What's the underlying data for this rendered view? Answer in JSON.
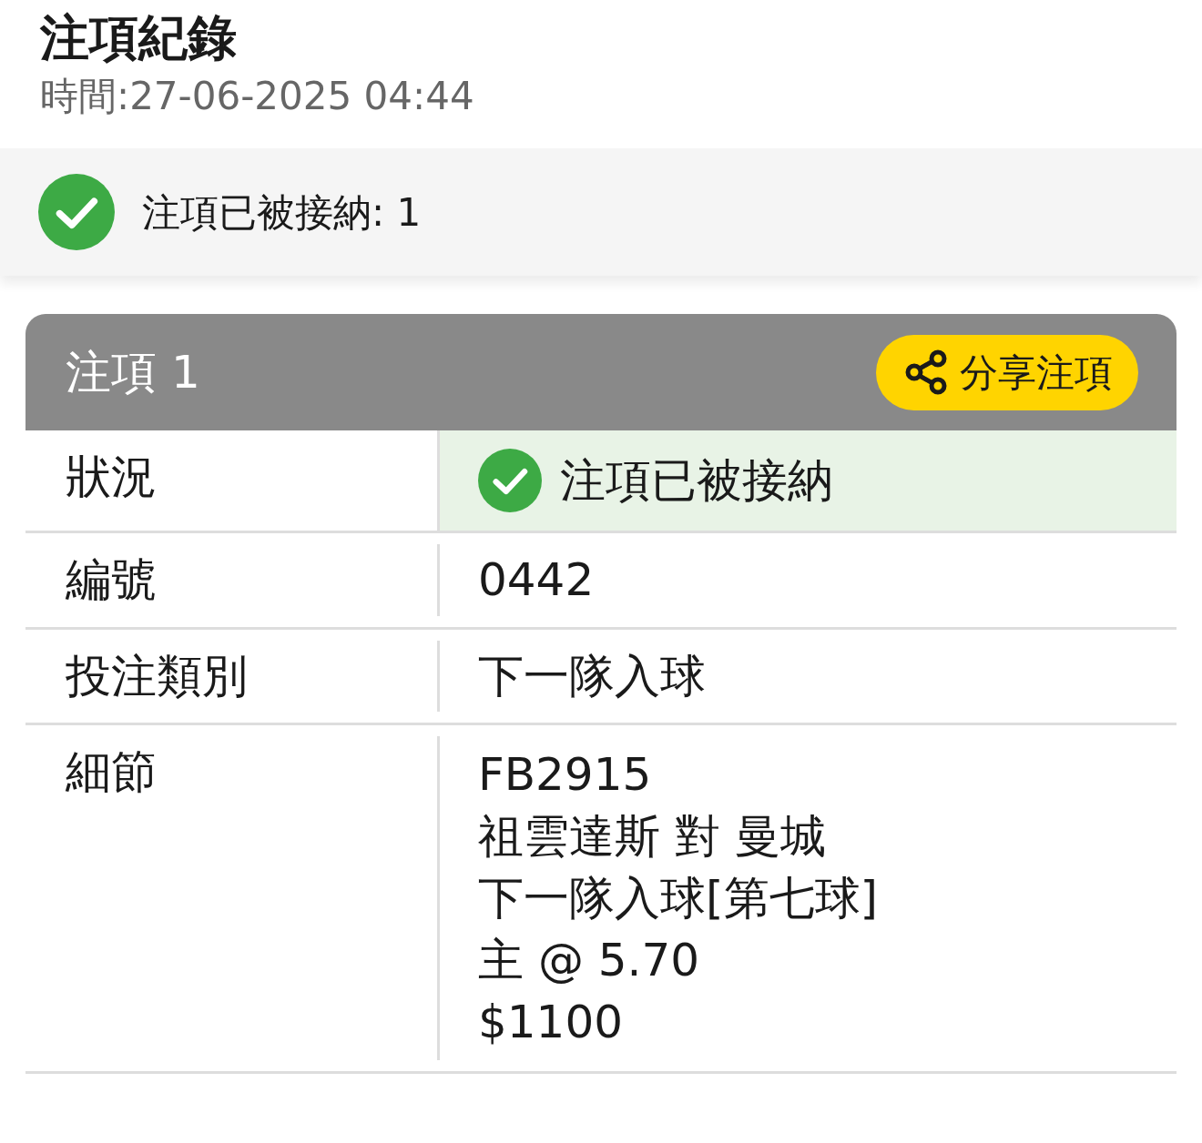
{
  "header": {
    "title": "注項紀錄",
    "time": "時間:27-06-2025 04:44"
  },
  "summary": {
    "accepted": true,
    "text": "注項已被接納: 1"
  },
  "bet": {
    "title": "注項 1",
    "share_button": "分享注項",
    "rows": [
      {
        "kind": "status",
        "label": "狀況",
        "value": "注項已被接納",
        "accepted": true
      },
      {
        "kind": "text",
        "label": "編號",
        "value": "0442"
      },
      {
        "kind": "text",
        "label": "投注類別",
        "value": "下一隊入球"
      },
      {
        "kind": "lines",
        "label": "細節",
        "lines": [
          "FB2915",
          "祖雲達斯 對 曼城",
          "下一隊入球[第七球]",
          "主 @ 5.70",
          "$1100"
        ]
      }
    ]
  }
}
